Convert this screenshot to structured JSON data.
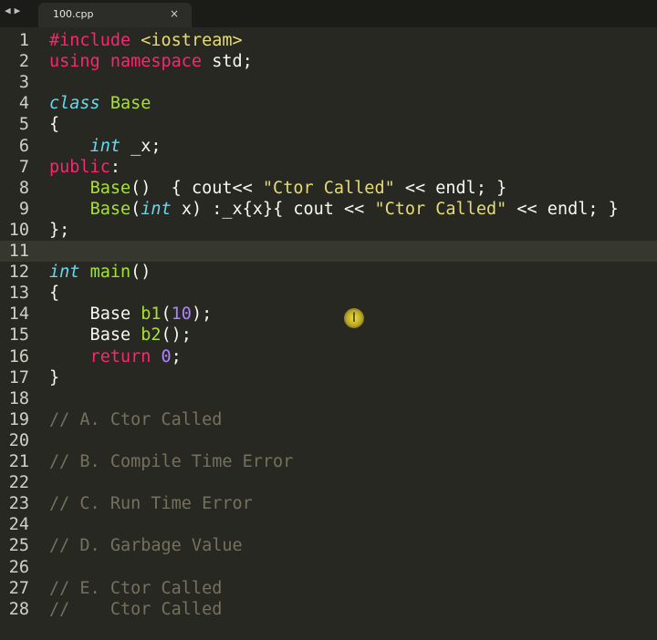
{
  "tabbar": {
    "back_label": "◀",
    "forward_label": "▶",
    "tab_title": "100.cpp",
    "close_label": "×"
  },
  "editor": {
    "active_line": 11,
    "lines": [
      {
        "n": "1",
        "tokens": [
          {
            "t": "#include ",
            "c": "k"
          },
          {
            "t": "<iostream>",
            "c": "s"
          }
        ]
      },
      {
        "n": "2",
        "tokens": [
          {
            "t": "using namespace ",
            "c": "k"
          },
          {
            "t": "std;",
            "c": ""
          }
        ]
      },
      {
        "n": "3",
        "tokens": []
      },
      {
        "n": "4",
        "tokens": [
          {
            "t": "class ",
            "c": "t"
          },
          {
            "t": "Base",
            "c": "c"
          }
        ]
      },
      {
        "n": "5",
        "tokens": [
          {
            "t": "{",
            "c": ""
          }
        ]
      },
      {
        "n": "6",
        "tokens": [
          {
            "t": "    ",
            "c": ""
          },
          {
            "t": "int",
            "c": "t"
          },
          {
            "t": " _x;",
            "c": ""
          }
        ]
      },
      {
        "n": "7",
        "tokens": [
          {
            "t": "public",
            "c": "k"
          },
          {
            "t": ":",
            "c": ""
          }
        ]
      },
      {
        "n": "8",
        "tokens": [
          {
            "t": "    ",
            "c": ""
          },
          {
            "t": "Base",
            "c": "c"
          },
          {
            "t": "()  { cout<< ",
            "c": ""
          },
          {
            "t": "\"Ctor Called\"",
            "c": "s"
          },
          {
            "t": " << endl; }",
            "c": ""
          }
        ]
      },
      {
        "n": "9",
        "tokens": [
          {
            "t": "    ",
            "c": ""
          },
          {
            "t": "Base",
            "c": "c"
          },
          {
            "t": "(",
            "c": ""
          },
          {
            "t": "int",
            "c": "t"
          },
          {
            "t": " x) :_x{x}{ cout << ",
            "c": ""
          },
          {
            "t": "\"Ctor Called\"",
            "c": "s"
          },
          {
            "t": " << endl; }",
            "c": ""
          }
        ]
      },
      {
        "n": "10",
        "tokens": [
          {
            "t": "};",
            "c": ""
          }
        ]
      },
      {
        "n": "11",
        "tokens": []
      },
      {
        "n": "12",
        "tokens": [
          {
            "t": "int",
            "c": "t"
          },
          {
            "t": " ",
            "c": ""
          },
          {
            "t": "main",
            "c": "c"
          },
          {
            "t": "()",
            "c": ""
          }
        ]
      },
      {
        "n": "13",
        "tokens": [
          {
            "t": "{",
            "c": ""
          }
        ]
      },
      {
        "n": "14",
        "tokens": [
          {
            "t": "    Base ",
            "c": ""
          },
          {
            "t": "b1",
            "c": "c"
          },
          {
            "t": "(",
            "c": ""
          },
          {
            "t": "10",
            "c": "n"
          },
          {
            "t": ");",
            "c": ""
          }
        ]
      },
      {
        "n": "15",
        "tokens": [
          {
            "t": "    Base ",
            "c": ""
          },
          {
            "t": "b2",
            "c": "c"
          },
          {
            "t": "();",
            "c": ""
          }
        ]
      },
      {
        "n": "16",
        "tokens": [
          {
            "t": "    ",
            "c": ""
          },
          {
            "t": "return",
            "c": "k"
          },
          {
            "t": " ",
            "c": ""
          },
          {
            "t": "0",
            "c": "n"
          },
          {
            "t": ";",
            "c": ""
          }
        ]
      },
      {
        "n": "17",
        "tokens": [
          {
            "t": "}",
            "c": ""
          }
        ]
      },
      {
        "n": "18",
        "tokens": []
      },
      {
        "n": "19",
        "tokens": [
          {
            "t": "// A. Ctor Called",
            "c": "cm"
          }
        ]
      },
      {
        "n": "20",
        "tokens": []
      },
      {
        "n": "21",
        "tokens": [
          {
            "t": "// B. Compile Time Error",
            "c": "cm"
          }
        ]
      },
      {
        "n": "22",
        "tokens": []
      },
      {
        "n": "23",
        "tokens": [
          {
            "t": "// C. Run Time Error",
            "c": "cm"
          }
        ]
      },
      {
        "n": "24",
        "tokens": []
      },
      {
        "n": "25",
        "tokens": [
          {
            "t": "// D. Garbage Value",
            "c": "cm"
          }
        ]
      },
      {
        "n": "26",
        "tokens": []
      },
      {
        "n": "27",
        "tokens": [
          {
            "t": "// E. Ctor Called",
            "c": "cm"
          }
        ]
      },
      {
        "n": "28",
        "tokens": [
          {
            "t": "//    Ctor Called",
            "c": "cm"
          }
        ]
      }
    ]
  },
  "cursor": {
    "symbol": "I",
    "icon": "text-cursor-icon"
  },
  "colors": {
    "background": "#272822",
    "keyword": "#f92672",
    "string": "#e6db74",
    "type": "#66d9ef",
    "class_name": "#a6e22e",
    "number": "#ae81ff",
    "comment": "#75715e"
  }
}
